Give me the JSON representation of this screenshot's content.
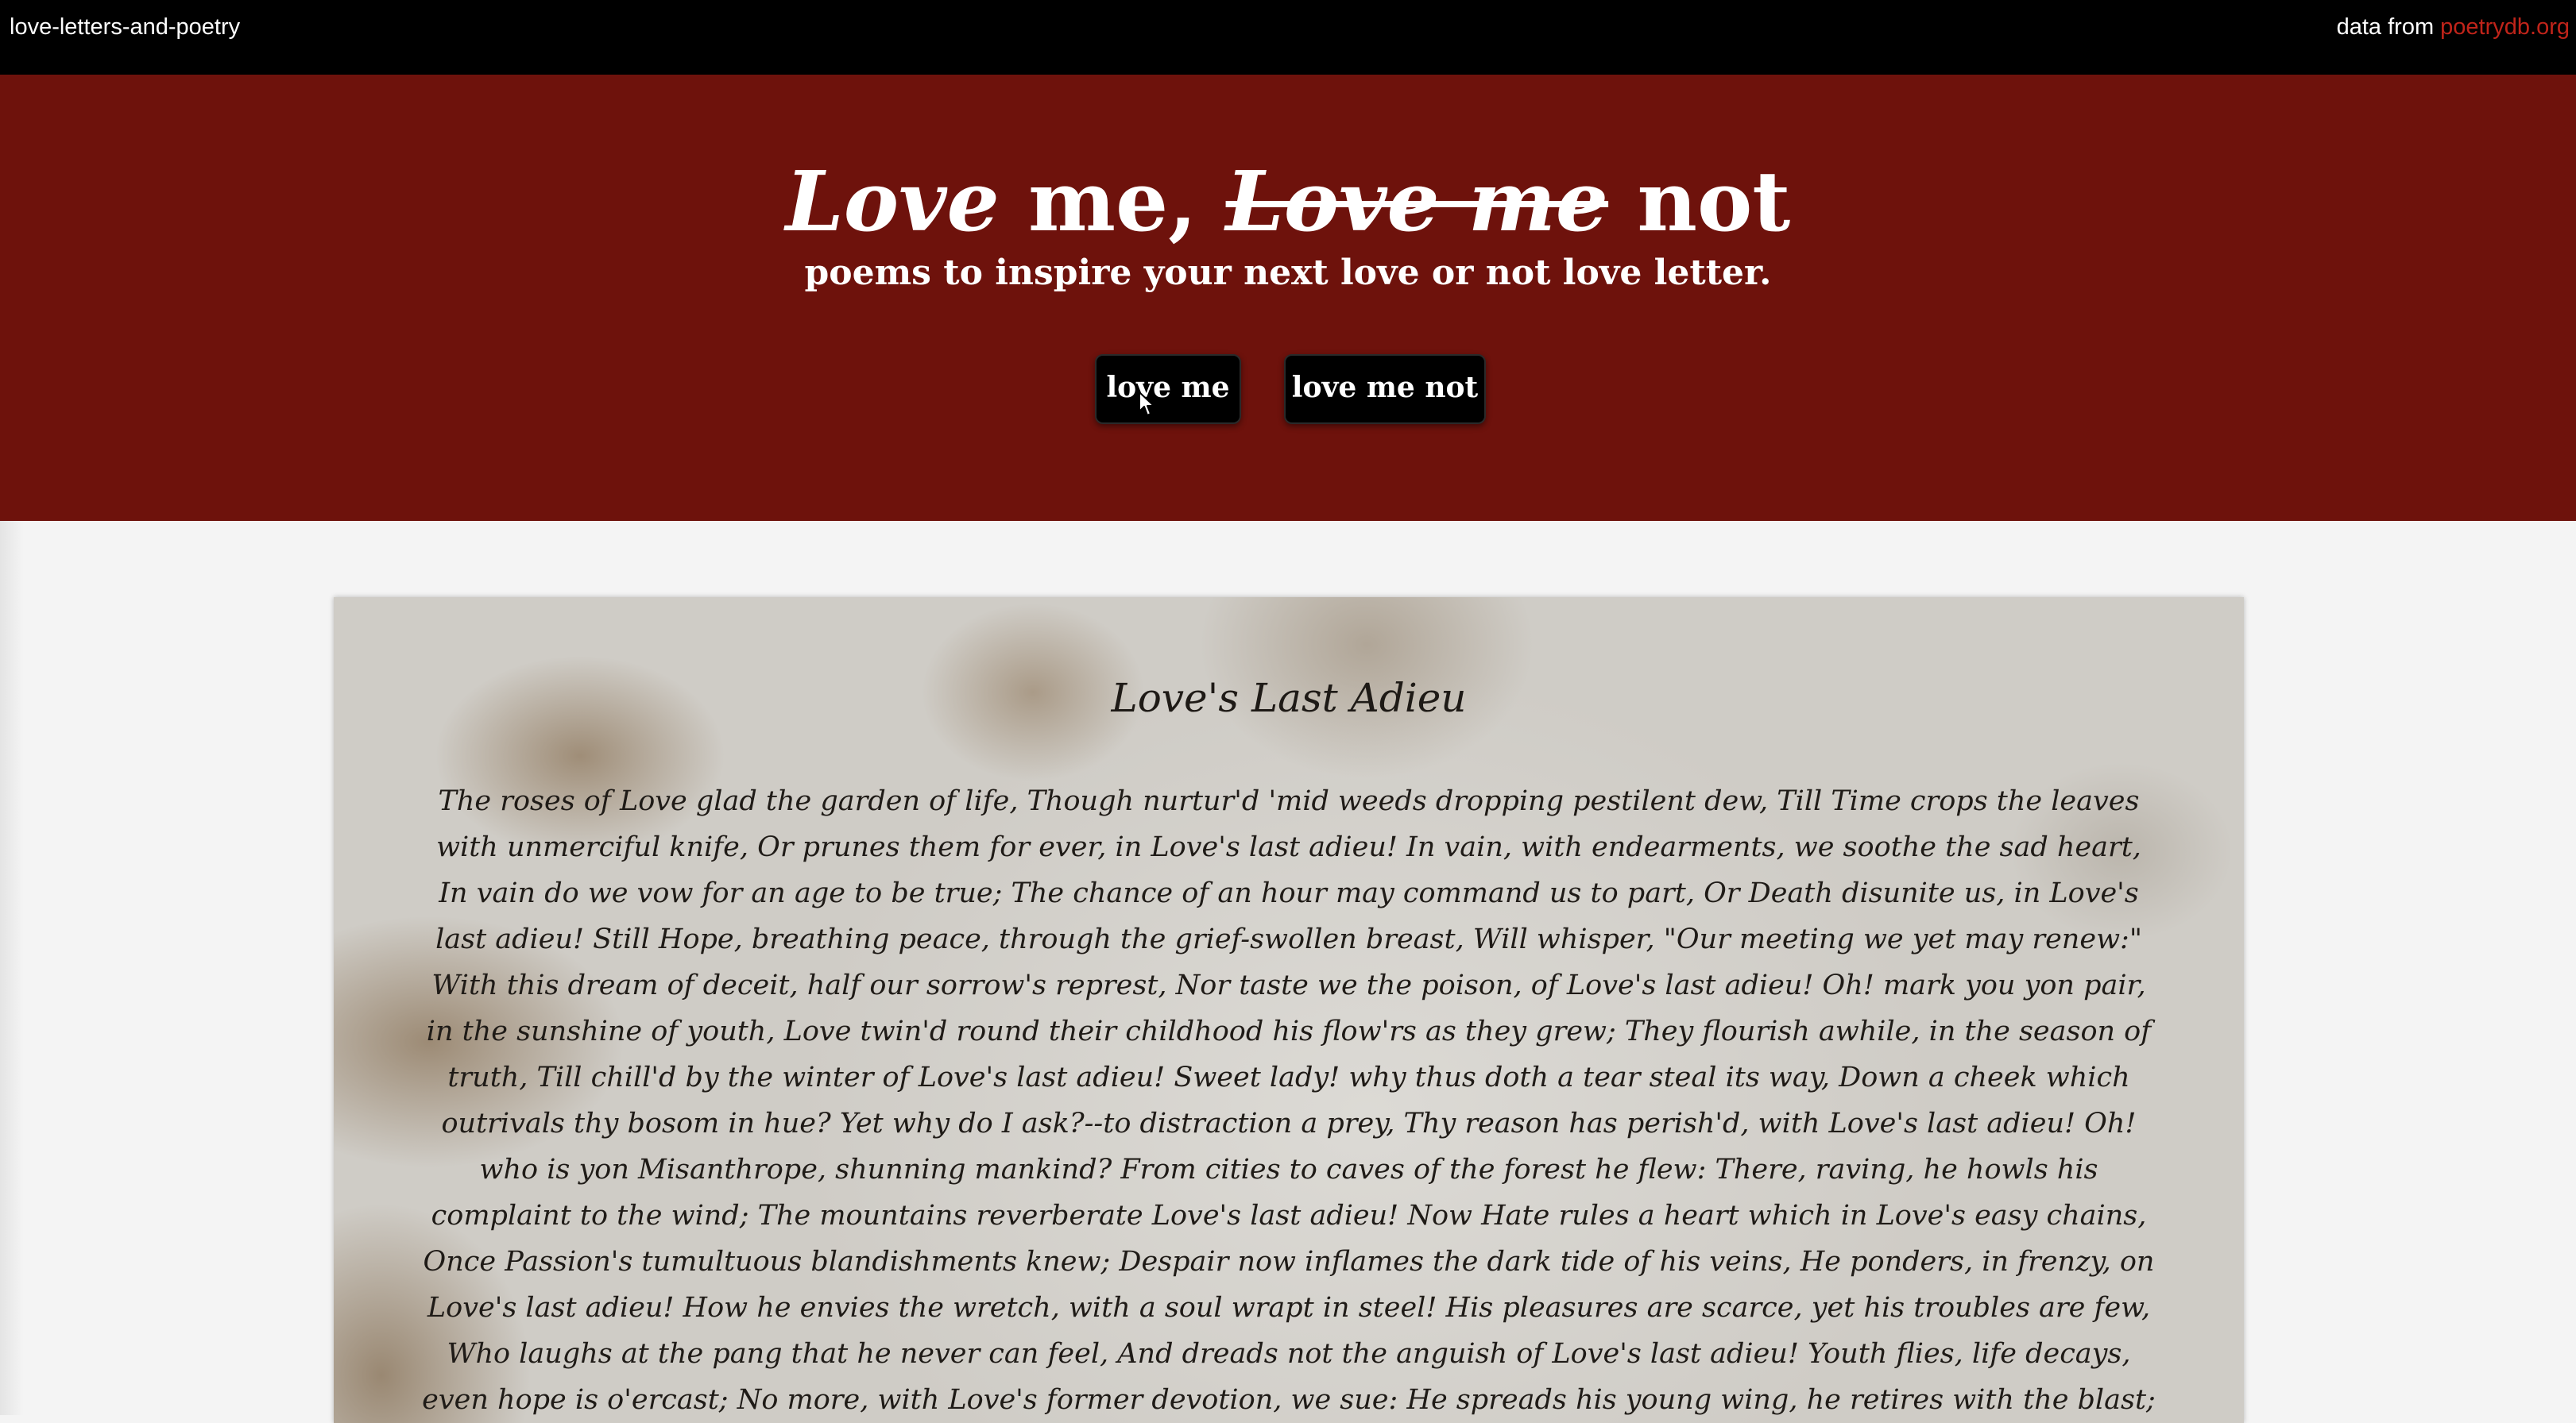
{
  "topbar": {
    "brand": "love-letters-and-poetry",
    "credit_prefix": "data from",
    "credit_link": "poetrydb.org"
  },
  "colors": {
    "topbar_bg": "#000000",
    "hero_bg": "#6e120c",
    "link_accent": "#c0241a",
    "page_bg": "#f4f4f4",
    "button_bg": "#000000"
  },
  "hero": {
    "title_love": "Love",
    "title_me": "me,",
    "title_struck": "Love me",
    "title_not": "not",
    "subtitle": "poems to inspire your next love or not love letter.",
    "buttons": {
      "love_me": "love me",
      "love_me_not": "love me not"
    }
  },
  "poem": {
    "title": "Love's Last Adieu",
    "body": "The roses of Love glad the garden of life, Though nurtur'd 'mid weeds dropping pestilent dew, Till Time crops the leaves with unmerciful knife, Or prunes them for ever, in Love's last adieu! In vain, with endearments, we soothe the sad heart, In vain do we vow for an age to be true; The chance of an hour may command us to part, Or Death disunite us, in Love's last adieu! Still Hope, breathing peace, through the grief-swollen breast, Will whisper, \"Our meeting we yet may renew:\" With this dream of deceit, half our sorrow's represt, Nor taste we the poison, of Love's last adieu! Oh! mark you yon pair, in the sunshine of youth, Love twin'd round their childhood his flow'rs as they grew; They flourish awhile, in the season of truth, Till chill'd by the winter of Love's last adieu! Sweet lady! why thus doth a tear steal its way, Down a cheek which outrivals thy bosom in hue? Yet why do I ask?--to distraction a prey, Thy reason has perish'd, with Love's last adieu! Oh! who is yon Misanthrope, shunning mankind? From cities to caves of the forest he flew: There, raving, he howls his complaint to the wind; The mountains reverberate Love's last adieu! Now Hate rules a heart which in Love's easy chains, Once Passion's tumultuous blandishments knew; Despair now inflames the dark tide of his veins, He ponders, in frenzy, on Love's last adieu! How he envies the wretch, with a soul wrapt in steel! His pleasures are scarce, yet his troubles are few, Who laughs at the pang that he never can feel, And dreads not the anguish of Love's last adieu! Youth flies, life decays, even hope is o'ercast; No more, with Love's former devotion, we sue: He spreads his young wing, he retires with the blast; The shroud of affection"
  }
}
